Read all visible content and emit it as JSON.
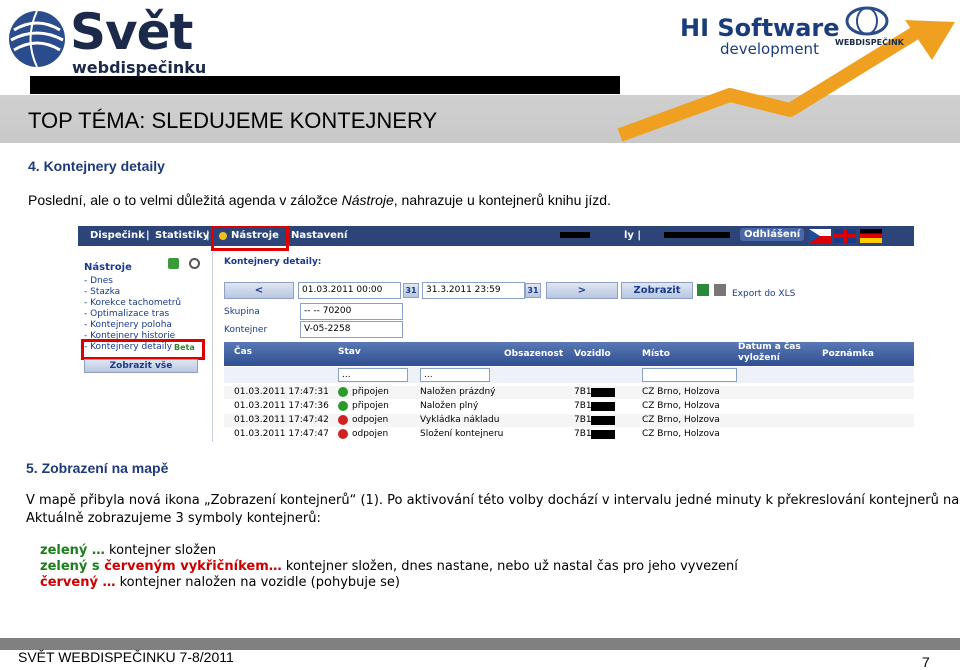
{
  "header": {
    "logo_main": "Svět",
    "logo_sub": "webdispečinku",
    "partner_logo": "HI Software",
    "partner_sub": "development",
    "partner_small": "WEBDISPEČINK",
    "title": "TOP TÉMA: SLEDUJEME KONTEJNERY"
  },
  "section4": {
    "heading": "4. Kontejnery detaily",
    "text_before": "Poslední, ale o to velmi důležitá agenda v záložce ",
    "text_italic": "Nástroje",
    "text_after": ", nahrazuje u kontejnerů knihu jízd."
  },
  "app": {
    "nav": [
      "Dispečink",
      "|",
      "Statistiky",
      "|",
      "Nástroje",
      "Nastavení"
    ],
    "logout": "Odhlášení",
    "user_partial": "ly |",
    "sidebar_title": "Nástroje",
    "sidebar_items": [
      "- Dnes",
      "- Stazka",
      "- Korekce tachometrů",
      "- Optimalizace tras",
      "- Kontejnery poloha",
      "- Kontejnery historie",
      "- Kontejnery detaily"
    ],
    "beta": "Beta",
    "show_all": "Zobrazit vše",
    "panel_title": "Kontejnery detaily:",
    "prev": "<",
    "next": ">",
    "date_from": "01.03.2011 00:00",
    "date_to": "31.3.2011 23:59",
    "cal": "31",
    "show_button": "Zobrazit",
    "export": "Export do XLS",
    "group_label": "Skupina",
    "group_value": "-- -- 70200",
    "container_label": "Kontejner",
    "container_value": "V-05-2258",
    "columns": [
      "Čas",
      "Stav",
      "Obsazenost",
      "Vozidlo",
      "Místo",
      "Datum a čas vyložení",
      "Poznámka"
    ],
    "filter_placeholder": "...",
    "rows": [
      {
        "time": "01.03.2011 17:47:31",
        "state": "připojen",
        "occupancy": "Naložen prázdný",
        "vehicle": "7B1",
        "place": "CZ Brno, Holzova"
      },
      {
        "time": "01.03.2011 17:47:36",
        "state": "připojen",
        "occupancy": "Naložen plný",
        "vehicle": "7B1",
        "place": "CZ Brno, Holzova"
      },
      {
        "time": "01.03.2011 17:47:42",
        "state": "odpojen",
        "occupancy": "Vykládka nákladu",
        "vehicle": "7B1",
        "place": "CZ Brno, Holzova"
      },
      {
        "time": "01.03.2011 17:47:47",
        "state": "odpojen",
        "occupancy": "Složení kontejneru",
        "vehicle": "7B1",
        "place": "CZ Brno, Holzova"
      }
    ]
  },
  "section5": {
    "heading": "5. Zobrazení na mapě",
    "p1_line1": "V mapě přibyla nová ikona „Zobrazení kontejnerů“ (1). Po aktivování této volby dochází v intervalu jedné minuty k překreslování kontejnerů na mapě.",
    "p1_line2": "Aktuálně zobrazujeme 3 symboly kontejnerů:",
    "legend": [
      {
        "label": "zelený …",
        "text": " kontejner složen"
      },
      {
        "label": "zelený s červeným vykřičníkem…",
        "text": " kontejner složen, dnes nastane, nebo už nastal čas pro jeho vyvezení"
      },
      {
        "label": "červený …",
        "text": " kontejner naložen na vozidle (pohybuje se)"
      }
    ]
  },
  "footer": {
    "text": "SVĚT WEBDISPEČINKU 7-8/2011",
    "page": "7"
  },
  "colors": {
    "nav": "#2c4478",
    "highlight": "#e00000",
    "green": "#1a7f1a",
    "red": "#cc0000"
  }
}
